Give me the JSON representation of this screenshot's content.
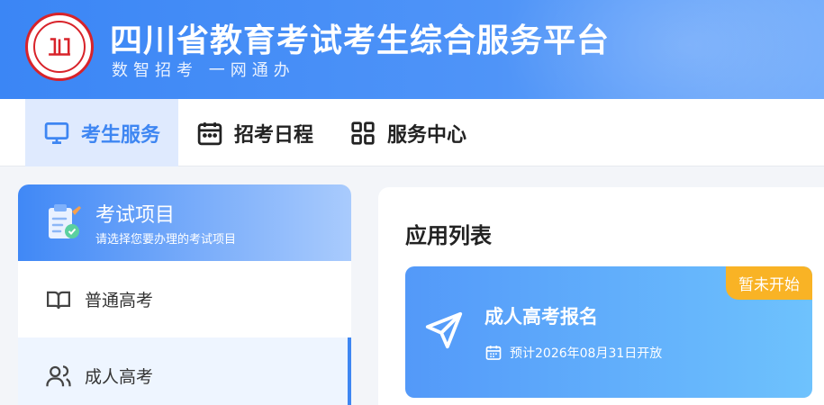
{
  "header": {
    "title": "四川省教育考试考生综合服务平台",
    "slogan": "数智招考 一网通办",
    "logo_icon": "sichuan-education-exam-seal",
    "colors": {
      "bg_start": "#3b86f5",
      "bg_end": "#72acfb",
      "seal": "#d8232a"
    }
  },
  "nav": {
    "tabs": [
      {
        "label": "考生服务",
        "icon": "monitor-icon",
        "active": true
      },
      {
        "label": "招考日程",
        "icon": "calendar-icon",
        "active": false
      },
      {
        "label": "服务中心",
        "icon": "grid-icon",
        "active": false
      }
    ],
    "accent": "#3e86f2"
  },
  "sidebar": {
    "header_title": "考试项目",
    "header_subtitle": "请选择您要办理的考试项目",
    "items": [
      {
        "label": "普通高考",
        "icon": "book-icon",
        "active": false
      },
      {
        "label": "成人高考",
        "icon": "users-icon",
        "active": true
      }
    ]
  },
  "main": {
    "section_title": "应用列表",
    "cards": [
      {
        "title": "成人高考报名",
        "date_text": "预计2026年08月31日开放",
        "badge": "暂未开始",
        "icon": "paper-plane-icon"
      }
    ]
  }
}
